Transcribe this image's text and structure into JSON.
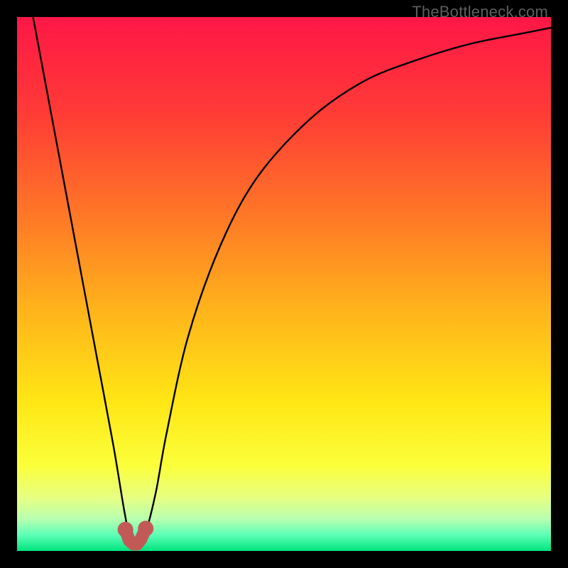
{
  "watermark": "TheBottleneck.com",
  "colors": {
    "frame": "#000000",
    "watermark": "#5e5e5e",
    "gradient_stops": [
      {
        "offset": 0.0,
        "color": "#ff1747"
      },
      {
        "offset": 0.18,
        "color": "#ff3b36"
      },
      {
        "offset": 0.38,
        "color": "#ff7a26"
      },
      {
        "offset": 0.55,
        "color": "#ffb41b"
      },
      {
        "offset": 0.72,
        "color": "#ffe615"
      },
      {
        "offset": 0.84,
        "color": "#fbff3a"
      },
      {
        "offset": 0.9,
        "color": "#e7ff82"
      },
      {
        "offset": 0.94,
        "color": "#b8ffb0"
      },
      {
        "offset": 0.97,
        "color": "#5dffb6"
      },
      {
        "offset": 1.0,
        "color": "#00e57e"
      }
    ],
    "curve_stroke": "#000000",
    "marker_fill": "#c15a57",
    "marker_stroke": "#c15a57"
  },
  "chart_data": {
    "type": "line",
    "title": "",
    "xlabel": "",
    "ylabel": "",
    "xlim": [
      0,
      100
    ],
    "ylim": [
      0,
      100
    ],
    "grid": false,
    "legend": false,
    "series": [
      {
        "name": "bottleneck-curve",
        "x": [
          3,
          6,
          9,
          12,
          15,
          18,
          20,
          21,
          22,
          23,
          24,
          26,
          28,
          32,
          38,
          45,
          55,
          65,
          75,
          85,
          95,
          100
        ],
        "y": [
          100,
          84,
          68,
          52,
          36,
          20,
          8,
          3,
          1,
          1,
          3,
          11,
          22,
          40,
          57,
          70,
          81,
          88,
          92,
          95,
          97,
          98
        ]
      }
    ],
    "markers": {
      "name": "min-marker",
      "x": [
        20.3,
        21.0,
        21.8,
        22.5,
        23.2,
        24.1
      ],
      "y": [
        4.0,
        2.0,
        1.3,
        1.3,
        2.2,
        4.2
      ]
    },
    "annotations": []
  }
}
